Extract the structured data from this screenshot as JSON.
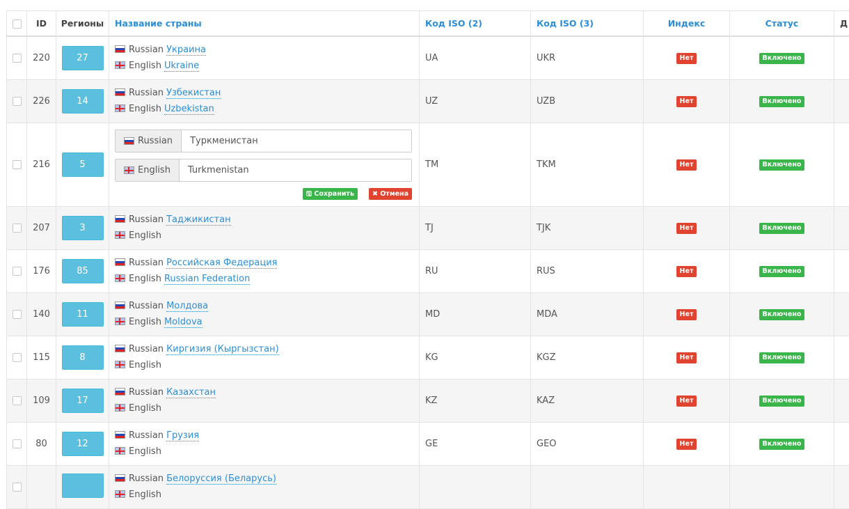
{
  "headers": {
    "id": "ID",
    "regions": "Регионы",
    "name": "Название страны",
    "iso2": "Код ISO (2)",
    "iso3": "Код ISO (3)",
    "index": "Индекс",
    "status": "Статус",
    "more": "Д"
  },
  "lang": {
    "ru": "Russian",
    "en": "English"
  },
  "labels": {
    "no": "Нет",
    "enabled": "Включено",
    "save": "Сохранить",
    "cancel": "Отмена"
  },
  "icons": {
    "save": "floppy-icon",
    "cancel": "x-icon",
    "flag_ru": "russia-flag-icon",
    "flag_en": "uk-flag-icon"
  },
  "colors": {
    "link": "#2b8ed6",
    "region_btn": "#5bc0de",
    "danger": "#e0432f",
    "success": "#39b54a"
  },
  "rows": [
    {
      "id": "220",
      "regions": "27",
      "ru": "Украина",
      "en": "Ukraine",
      "iso2": "UA",
      "iso3": "UKR"
    },
    {
      "id": "226",
      "regions": "14",
      "ru": "Узбекистан",
      "en": "Uzbekistan",
      "iso2": "UZ",
      "iso3": "UZB"
    },
    {
      "id": "216",
      "regions": "5",
      "ru": "Туркменистан",
      "en": "Turkmenistan",
      "iso2": "TM",
      "iso3": "TKM",
      "editing": true
    },
    {
      "id": "207",
      "regions": "3",
      "ru": "Таджикистан",
      "en": "",
      "iso2": "TJ",
      "iso3": "TJK"
    },
    {
      "id": "176",
      "regions": "85",
      "ru": "Российская Федерация",
      "en": "Russian Federation",
      "iso2": "RU",
      "iso3": "RUS"
    },
    {
      "id": "140",
      "regions": "11",
      "ru": "Молдова",
      "en": "Moldova",
      "iso2": "MD",
      "iso3": "MDA"
    },
    {
      "id": "115",
      "regions": "8",
      "ru": "Киргизия (Кыргызстан)",
      "en": "",
      "iso2": "KG",
      "iso3": "KGZ"
    },
    {
      "id": "109",
      "regions": "17",
      "ru": "Казахстан",
      "en": "",
      "iso2": "KZ",
      "iso3": "KAZ"
    },
    {
      "id": "80",
      "regions": "12",
      "ru": "Грузия",
      "en": "",
      "iso2": "GE",
      "iso3": "GEO"
    },
    {
      "id": "",
      "regions": "",
      "ru": "Белоруссия (Беларусь)",
      "en": "",
      "iso2": "",
      "iso3": ""
    }
  ]
}
